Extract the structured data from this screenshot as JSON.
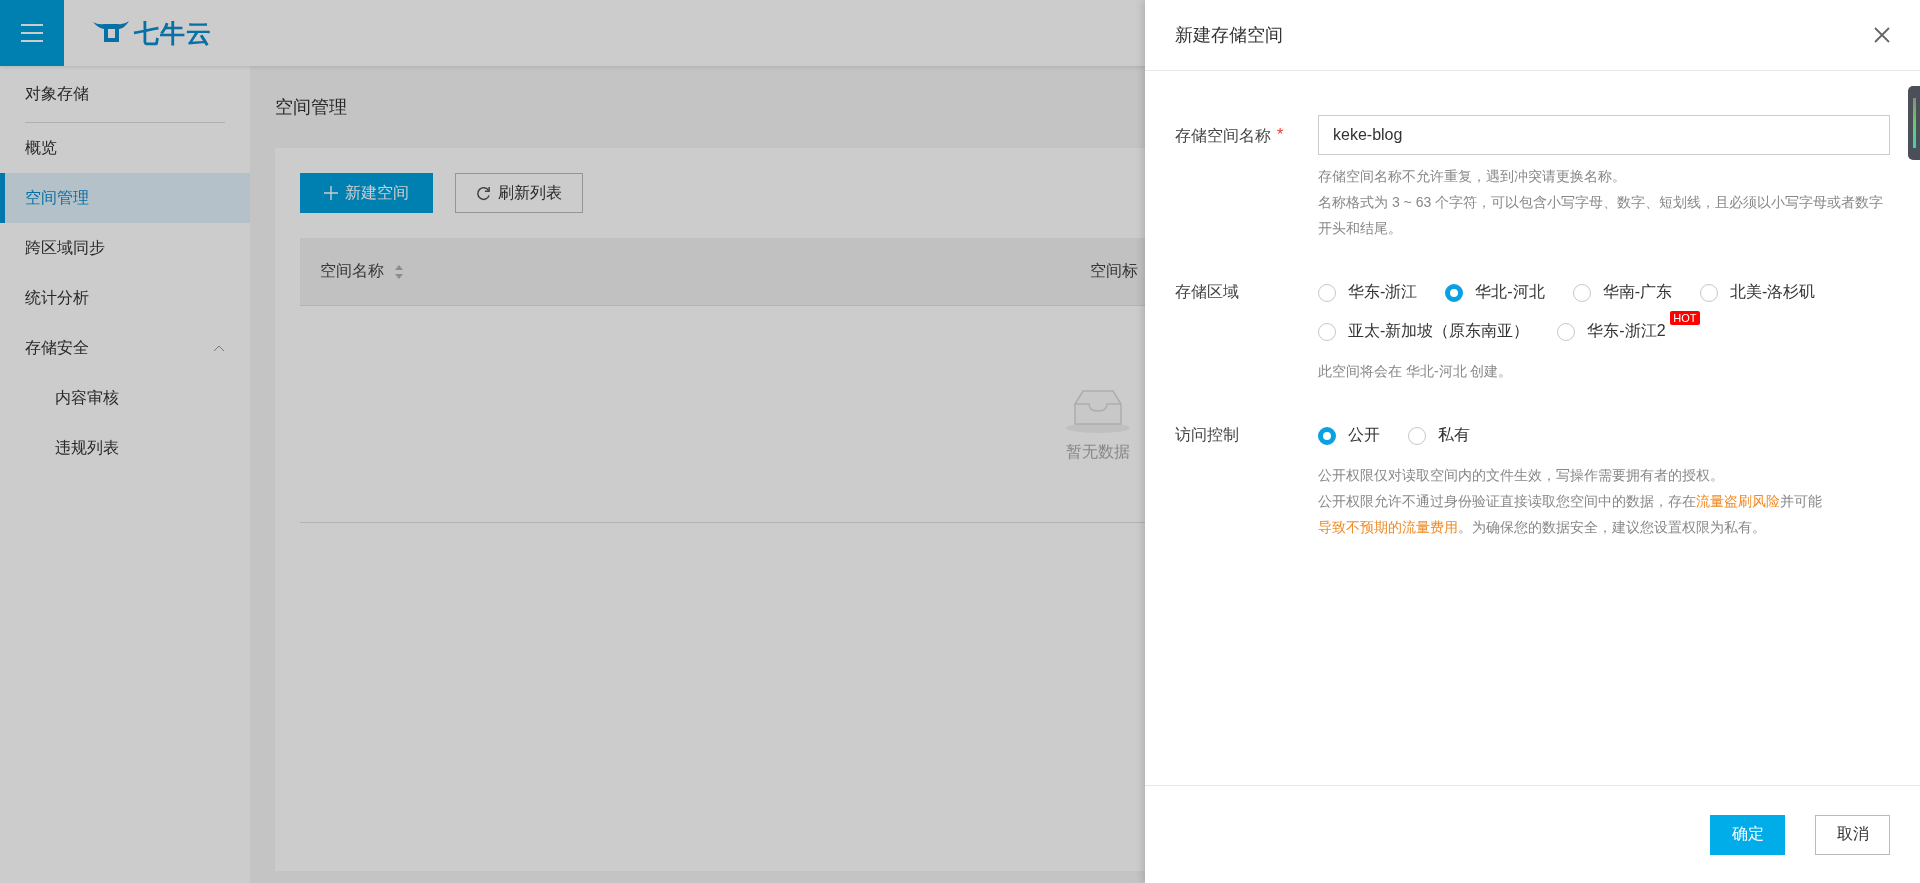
{
  "header": {
    "logo": "七牛云"
  },
  "sidebar": {
    "title": "对象存储",
    "items": [
      {
        "label": "概览",
        "selected": false
      },
      {
        "label": "空间管理",
        "selected": true
      },
      {
        "label": "跨区域同步",
        "selected": false
      },
      {
        "label": "统计分析",
        "selected": false
      },
      {
        "label": "存储安全",
        "selected": false,
        "expanded": true,
        "children": [
          {
            "label": "内容审核",
            "selected": false
          },
          {
            "label": "违规列表",
            "selected": false
          }
        ]
      }
    ]
  },
  "page": {
    "title": "空间管理",
    "buttons": [
      {
        "label": "新建空间",
        "kind": "primary"
      },
      {
        "label": "刷新列表",
        "kind": "refresh"
      }
    ],
    "table": {
      "columns": [
        {
          "label": "空间名称",
          "sortable": true
        },
        {
          "label": "空间标",
          "sortable": false
        }
      ],
      "empty_text": "暂无数据"
    }
  },
  "drawer": {
    "title": "新建存储空间",
    "fields": [
      {
        "kind": "text",
        "label": "存储空间名称",
        "required_mark": "*",
        "value": "keke-blog",
        "help": [
          [
            {
              "kind": "plain",
              "text": "存储空间名称不允许重复，遇到冲突请更换名称。"
            }
          ],
          [
            {
              "kind": "plain",
              "text": "名称格式为 3 ~ 63 个字符，可以包含小写字母、数字、短划线，且必须以小写字母或者数字开头和结尾。"
            }
          ]
        ]
      },
      {
        "kind": "radio",
        "label": "存储区域",
        "options": [
          {
            "label": "华东-浙江",
            "selected": false
          },
          {
            "label": "华北-河北",
            "selected": true
          },
          {
            "label": "华南-广东",
            "selected": false
          },
          {
            "label": "北美-洛杉矶",
            "selected": false
          },
          {
            "label": "亚太-新加坡（原东南亚）",
            "selected": false
          },
          {
            "label": "华东-浙江2",
            "selected": false,
            "badge": "HOT"
          }
        ],
        "help": [
          [
            {
              "kind": "plain",
              "text": "此空间将会在 华北-河北 创建。"
            }
          ]
        ]
      },
      {
        "kind": "radio",
        "label": "访问控制",
        "options": [
          {
            "label": "公开",
            "selected": true
          },
          {
            "label": "私有",
            "selected": false
          }
        ],
        "help": [
          [
            {
              "kind": "plain",
              "text": "公开权限仅对读取空间内的文件生效，写操作需要拥有者的授权。"
            }
          ],
          [
            {
              "kind": "plain",
              "text": "公开权限允许不通过身份验证直接读取您空间中的数据，存在"
            },
            {
              "kind": "link",
              "text": "流量盗刷风险"
            },
            {
              "kind": "plain",
              "text": "并可能"
            },
            {
              "kind": "link",
              "text": "导致不预期的流量费用"
            },
            {
              "kind": "plain",
              "text": "。为确保您的数据安全，建议您设置权限为私有。"
            }
          ]
        ]
      }
    ],
    "buttons": [
      {
        "label": "确定",
        "kind": "primary"
      },
      {
        "label": "取消",
        "kind": "default"
      }
    ]
  }
}
